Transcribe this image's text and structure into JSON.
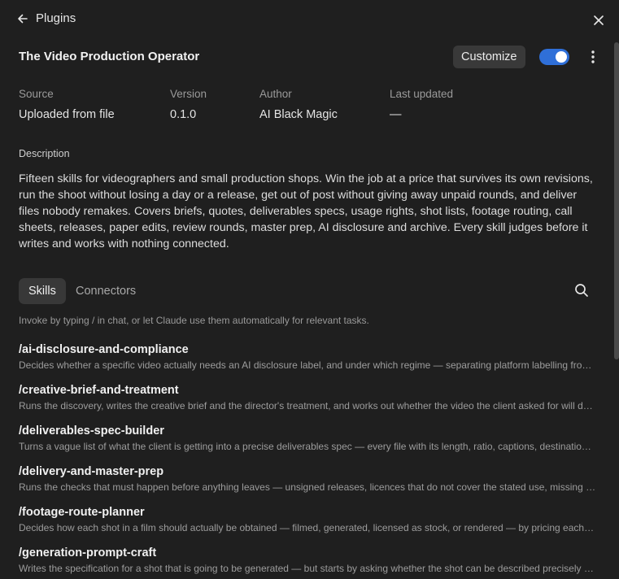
{
  "header": {
    "back_label": "Plugins"
  },
  "plugin": {
    "title": "The Video Production Operator",
    "customize_label": "Customize",
    "enabled": true
  },
  "meta": [
    {
      "label": "Source",
      "value": "Uploaded from file"
    },
    {
      "label": "Version",
      "value": "0.1.0"
    },
    {
      "label": "Author",
      "value": "AI Black Magic"
    },
    {
      "label": "Last updated",
      "value": "—"
    }
  ],
  "description": {
    "label": "Description",
    "text": "Fifteen skills for videographers and small production shops. Win the job at a price that survives its own revisions, run the shoot without losing a day or a release, get out of post without giving away unpaid rounds, and deliver files nobody remakes. Covers briefs, quotes, deliverables specs, usage rights, shot lists, footage routing, call sheets, releases, paper edits, review rounds, master prep, AI disclosure and archive. Every skill judges before it writes and works with nothing connected."
  },
  "tabs": [
    {
      "label": "Skills",
      "active": true
    },
    {
      "label": "Connectors",
      "active": false
    }
  ],
  "hint": "Invoke by typing / in chat, or let Claude use them automatically for relevant tasks.",
  "skills": [
    {
      "name": "/ai-disclosure-and-compliance",
      "desc": "Decides whether a specific video actually needs an AI disclosure label, and under which regime — separating platform labelling from legal disclosure"
    },
    {
      "name": "/creative-brief-and-treatment",
      "desc": "Runs the discovery, writes the creative brief and the director's treatment, and works out whether the video the client asked for will do what they need"
    },
    {
      "name": "/deliverables-spec-builder",
      "desc": "Turns a vague list of what the client is getting into a precise deliverables spec — every file with its length, ratio, captions, destination and format"
    },
    {
      "name": "/delivery-and-master-prep",
      "desc": "Runs the checks that must happen before anything leaves — unsigned releases, licences that do not cover the stated use, missing captions and more"
    },
    {
      "name": "/footage-route-planner",
      "desc": "Decides how each shot in a film should actually be obtained — filmed, generated, licensed as stock, or rendered — by pricing each route honestly"
    },
    {
      "name": "/generation-prompt-craft",
      "desc": "Writes the specification for a shot that is going to be generated — but starts by asking whether the shot can be described precisely enough"
    }
  ]
}
